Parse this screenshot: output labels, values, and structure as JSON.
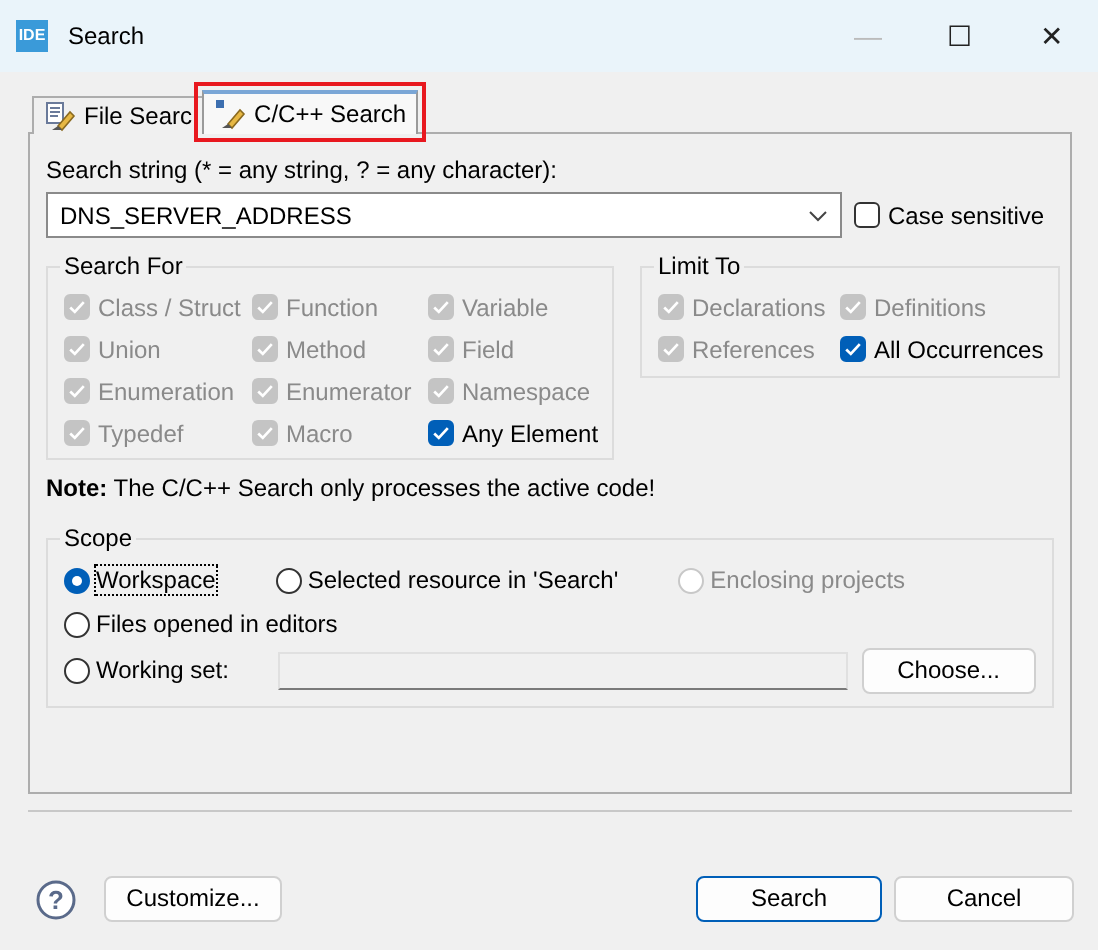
{
  "window": {
    "logo": "IDE",
    "title": "Search",
    "controls": [
      "—",
      "☐",
      "✕"
    ]
  },
  "tabs": [
    {
      "label": "File Searc",
      "selected": false,
      "highlighted": false
    },
    {
      "label": "C/C++ Search",
      "selected": true,
      "highlighted": true
    }
  ],
  "search_string": {
    "label": "Search string (* = any string, ? = any character):",
    "value": "DNS_SERVER_ADDRESS",
    "case_sensitive": {
      "label": "Case sensitive",
      "checked": false,
      "disabled": false
    }
  },
  "search_for": {
    "title": "Search For",
    "options": [
      {
        "label": "Class / Struct",
        "checked": true,
        "disabled": true
      },
      {
        "label": "Function",
        "checked": true,
        "disabled": true
      },
      {
        "label": "Variable",
        "checked": true,
        "disabled": true
      },
      {
        "label": "Union",
        "checked": true,
        "disabled": true
      },
      {
        "label": "Method",
        "checked": true,
        "disabled": true
      },
      {
        "label": "Field",
        "checked": true,
        "disabled": true
      },
      {
        "label": "Enumeration",
        "checked": true,
        "disabled": true
      },
      {
        "label": "Enumerator",
        "checked": true,
        "disabled": true
      },
      {
        "label": "Namespace",
        "checked": true,
        "disabled": true
      },
      {
        "label": "Typedef",
        "checked": true,
        "disabled": true
      },
      {
        "label": "Macro",
        "checked": true,
        "disabled": true
      },
      {
        "label": "Any Element",
        "checked": true,
        "disabled": false
      }
    ]
  },
  "limit_to": {
    "title": "Limit To",
    "options": [
      {
        "label": "Declarations",
        "checked": true,
        "disabled": true
      },
      {
        "label": "Definitions",
        "checked": true,
        "disabled": true
      },
      {
        "label": "References",
        "checked": true,
        "disabled": true
      },
      {
        "label": "All Occurrences",
        "checked": true,
        "disabled": false
      }
    ]
  },
  "note": "**Note:** The C/C++ Search only processes the active code!",
  "scope": {
    "title": "Scope",
    "options": [
      {
        "label": "Workspace",
        "selected": true,
        "disabled": false
      },
      {
        "label": "Selected resource in 'Search'",
        "selected": false,
        "disabled": false
      },
      {
        "label": "Enclosing projects",
        "selected": false,
        "disabled": true
      },
      {
        "label": "Files opened in editors",
        "selected": false,
        "disabled": false
      },
      {
        "label": "Working set:",
        "selected": false,
        "disabled": false
      }
    ],
    "choose_button": "Choose..."
  },
  "buttons": {
    "help": "?",
    "customize": "Customize...",
    "search": "Search",
    "cancel": "Cancel"
  }
}
